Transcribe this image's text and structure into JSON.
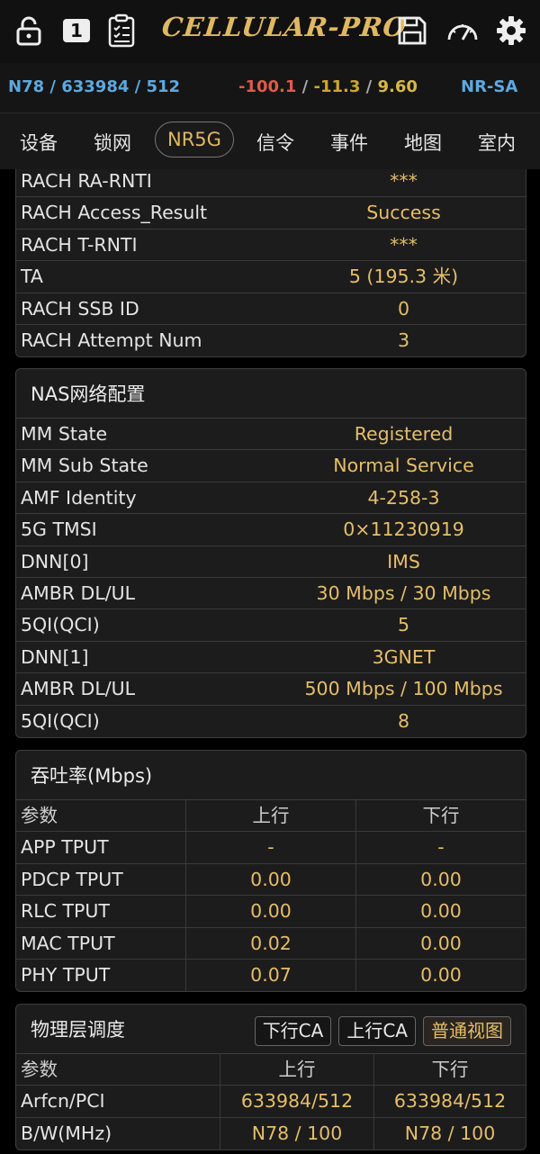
{
  "app": {
    "logo": "Cellular-Pro",
    "lock_badge": "1"
  },
  "status": {
    "band_info": "N78 / 633984 / 512",
    "rsrp": "-100.1",
    "rsrq": "-11.3",
    "sinr": "9.60",
    "sep": " / ",
    "mode": "NR-SA",
    "colors": {
      "band": "#5da8e0",
      "rsrp": "#e05a4a",
      "rsrq": "#cda72a",
      "sinr": "#d7b74a"
    }
  },
  "tabs": [
    {
      "label": "设备"
    },
    {
      "label": "锁网"
    },
    {
      "label": "NR5G"
    },
    {
      "label": "信令"
    },
    {
      "label": "事件"
    },
    {
      "label": "地图"
    },
    {
      "label": "室内"
    }
  ],
  "rach": [
    {
      "key": "RACH RA-RNTI",
      "value": "***"
    },
    {
      "key": "RACH Access_Result",
      "value": "Success"
    },
    {
      "key": "RACH T-RNTI",
      "value": "***"
    },
    {
      "key": "TA",
      "value": "5 (195.3 米)"
    },
    {
      "key": "RACH SSB ID",
      "value": "0"
    },
    {
      "key": "RACH Attempt Num",
      "value": "3"
    }
  ],
  "nas": {
    "title": "NAS网络配置",
    "rows": [
      {
        "key": "MM State",
        "value": "Registered"
      },
      {
        "key": "MM Sub State",
        "value": "Normal Service"
      },
      {
        "key": "AMF Identity",
        "value": "4-258-3"
      },
      {
        "key": "5G TMSI",
        "value": "0×11230919"
      },
      {
        "key": "DNN[0]",
        "value": "IMS"
      },
      {
        "key": "AMBR DL/UL",
        "value": "30  Mbps / 30  Mbps"
      },
      {
        "key": "5QI(QCI)",
        "value": "5"
      },
      {
        "key": "DNN[1]",
        "value": "3GNET"
      },
      {
        "key": "AMBR DL/UL",
        "value": "500  Mbps / 100  Mbps"
      },
      {
        "key": "5QI(QCI)",
        "value": "8"
      }
    ]
  },
  "throughput": {
    "title": "吞吐率(Mbps)",
    "headers": [
      "参数",
      "上行",
      "下行"
    ],
    "rows": [
      [
        "APP TPUT",
        "-",
        "-"
      ],
      [
        "PDCP TPUT",
        "0.00",
        "0.00"
      ],
      [
        "RLC TPUT",
        "0.00",
        "0.00"
      ],
      [
        "MAC TPUT",
        "0.02",
        "0.00"
      ],
      [
        "PHY TPUT",
        "0.07",
        "0.00"
      ]
    ]
  },
  "phy": {
    "title": "物理层调度",
    "buttons": [
      "下行CA",
      "上行CA",
      "普通视图"
    ],
    "headers": [
      "参数",
      "上行",
      "下行"
    ],
    "rows": [
      [
        "Arfcn/PCI",
        "633984/512",
        "633984/512"
      ],
      [
        "B/W(MHz)",
        "N78 / 100",
        "N78 / 100"
      ]
    ]
  }
}
